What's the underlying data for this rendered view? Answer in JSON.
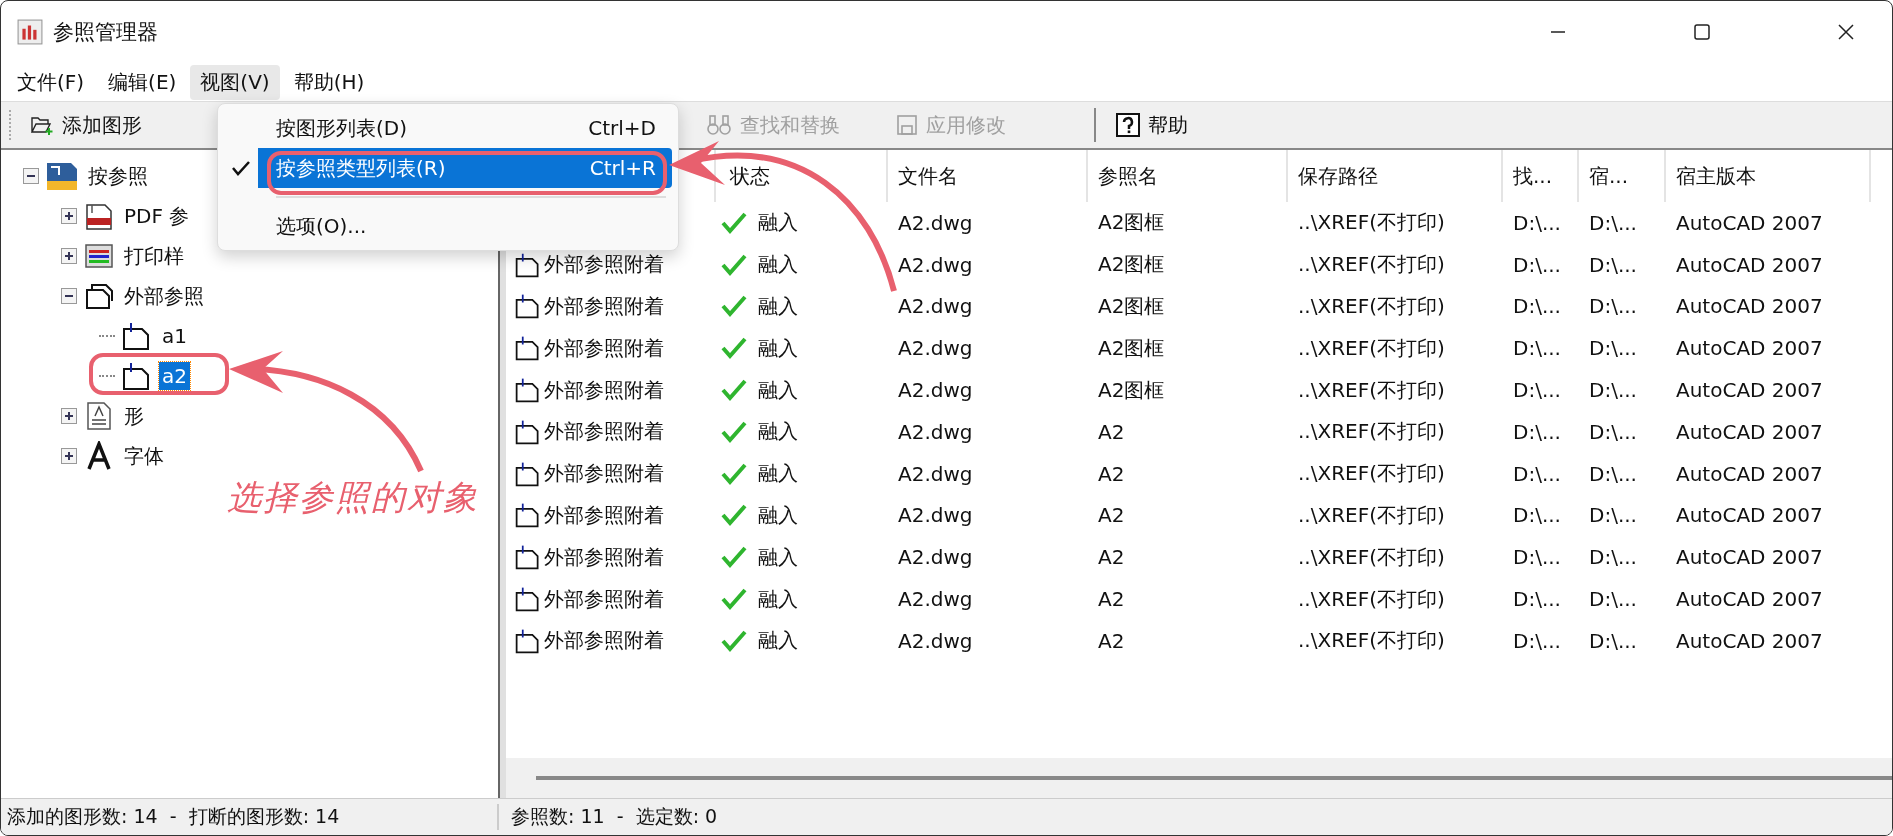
{
  "window": {
    "title": "参照管理器"
  },
  "menubar": [
    {
      "label": "文件(F)",
      "selected": false
    },
    {
      "label": "编辑(E)",
      "selected": false
    },
    {
      "label": "视图(V)",
      "selected": true
    },
    {
      "label": "帮助(H)",
      "selected": false
    }
  ],
  "toolbar": {
    "left": [
      {
        "kind": "add",
        "label": "添加图形",
        "disabled": false
      }
    ],
    "right": [
      {
        "kind": "find",
        "label": "查找和替换",
        "disabled": true
      },
      {
        "kind": "apply",
        "label": "应用修改",
        "disabled": true
      },
      {
        "kind": "help",
        "label": "帮助",
        "disabled": false
      }
    ]
  },
  "tree": [
    {
      "kind": "root",
      "label": "按参照",
      "expanded": true,
      "selected": false,
      "children": [
        {
          "kind": "pdf",
          "label": "PDF 参",
          "expanded": false,
          "selected": false
        },
        {
          "kind": "plot-style",
          "label": "打印样",
          "expanded": false,
          "selected": false
        },
        {
          "kind": "xref",
          "label": "外部参照",
          "expanded": true,
          "selected": false,
          "children": [
            {
              "kind": "xref-file",
              "label": "a1",
              "selected": false
            },
            {
              "kind": "xref-file",
              "label": "a2",
              "selected": true
            }
          ]
        },
        {
          "kind": "shape",
          "label": "形",
          "expanded": false,
          "selected": false
        },
        {
          "kind": "font",
          "label": "字体",
          "expanded": false,
          "selected": false
        }
      ]
    }
  ],
  "table": {
    "columns": [
      "状态",
      "文件名",
      "参照名",
      "保存路径",
      "找...",
      "宿...",
      "宿主版本"
    ],
    "rows": [
      {
        "status": "融入",
        "file": "A2.dwg",
        "ref_name": "A2图框",
        "path": "..\\XREF(不打印)",
        "found": "D:\\...",
        "host": "D:\\...",
        "version": "AutoCAD 2007"
      },
      {
        "type": "外部参照附着",
        "status": "融入",
        "file": "A2.dwg",
        "ref_name": "A2图框",
        "path": "..\\XREF(不打印)",
        "found": "D:\\...",
        "host": "D:\\...",
        "version": "AutoCAD 2007"
      },
      {
        "type": "外部参照附着",
        "status": "融入",
        "file": "A2.dwg",
        "ref_name": "A2图框",
        "path": "..\\XREF(不打印)",
        "found": "D:\\...",
        "host": "D:\\...",
        "version": "AutoCAD 2007"
      },
      {
        "type": "外部参照附着",
        "status": "融入",
        "file": "A2.dwg",
        "ref_name": "A2图框",
        "path": "..\\XREF(不打印)",
        "found": "D:\\...",
        "host": "D:\\...",
        "version": "AutoCAD 2007"
      },
      {
        "type": "外部参照附着",
        "status": "融入",
        "file": "A2.dwg",
        "ref_name": "A2图框",
        "path": "..\\XREF(不打印)",
        "found": "D:\\...",
        "host": "D:\\...",
        "version": "AutoCAD 2007"
      },
      {
        "type": "外部参照附着",
        "status": "融入",
        "file": "A2.dwg",
        "ref_name": "A2",
        "path": "..\\XREF(不打印)",
        "found": "D:\\...",
        "host": "D:\\...",
        "version": "AutoCAD 2007"
      },
      {
        "type": "外部参照附着",
        "status": "融入",
        "file": "A2.dwg",
        "ref_name": "A2",
        "path": "..\\XREF(不打印)",
        "found": "D:\\...",
        "host": "D:\\...",
        "version": "AutoCAD 2007"
      },
      {
        "type": "外部参照附着",
        "status": "融入",
        "file": "A2.dwg",
        "ref_name": "A2",
        "path": "..\\XREF(不打印)",
        "found": "D:\\...",
        "host": "D:\\...",
        "version": "AutoCAD 2007"
      },
      {
        "type": "外部参照附着",
        "status": "融入",
        "file": "A2.dwg",
        "ref_name": "A2",
        "path": "..\\XREF(不打印)",
        "found": "D:\\...",
        "host": "D:\\...",
        "version": "AutoCAD 2007"
      },
      {
        "type": "外部参照附着",
        "status": "融入",
        "file": "A2.dwg",
        "ref_name": "A2",
        "path": "..\\XREF(不打印)",
        "found": "D:\\...",
        "host": "D:\\...",
        "version": "AutoCAD 2007"
      },
      {
        "type": "外部参照附着",
        "status": "融入",
        "file": "A2.dwg",
        "ref_name": "A2",
        "path": "..\\XREF(不打印)",
        "found": "D:\\...",
        "host": "D:\\...",
        "version": "AutoCAD 2007"
      }
    ]
  },
  "status_bar": [
    "添加的图形数: 14  -  打断的图形数: 14",
    "参照数: 11  -  选定数: 0"
  ],
  "dropdown_menu": [
    {
      "kind": "item",
      "label": "按图形列表(D)",
      "shortcut": "Ctrl+D",
      "checked": false,
      "selected": false
    },
    {
      "kind": "item",
      "label": "按参照类型列表(R)",
      "shortcut": "Ctrl+R",
      "checked": true,
      "selected": true
    },
    {
      "kind": "separator"
    },
    {
      "kind": "item",
      "label": "选项(O)...",
      "checked": false,
      "selected": false
    }
  ],
  "annotation": {
    "text": "选择参照的对象"
  }
}
